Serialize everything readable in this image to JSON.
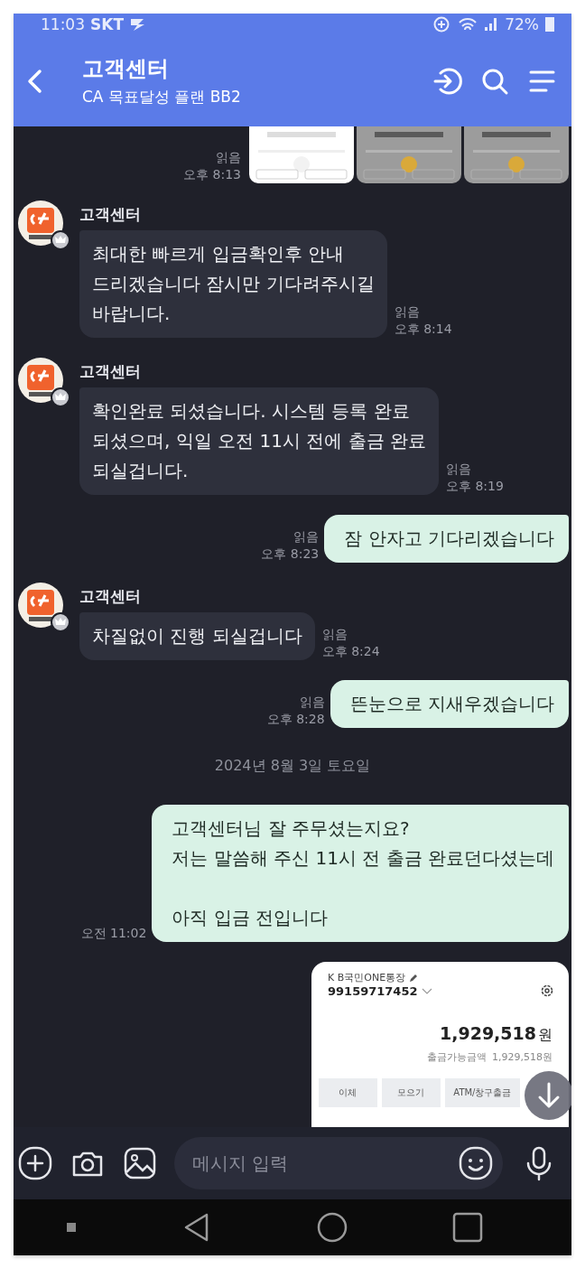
{
  "status_bar": {
    "time": "11:03",
    "carrier": "SKT",
    "battery": "72%"
  },
  "header": {
    "title": "고객센터",
    "subtitle": "CA 목표달성 플랜 BB2"
  },
  "messages": [
    {
      "kind": "images",
      "read": "읽음",
      "time": "오후 8:13"
    },
    {
      "kind": "incoming",
      "sender": "고객센터",
      "text": "최대한 빠르게 입금확인후 안내\n드리겠습니다 잠시만 기다려주시길\n바랍니다.",
      "read": "읽음",
      "time": "오후 8:14"
    },
    {
      "kind": "incoming",
      "sender": "고객센터",
      "text": "확인완료 되셨습니다. 시스템 등록 완료\n되셨으며, 익일 오전 11시 전에 출금 완료\n되실겁니다.",
      "read": "읽음",
      "time": "오후 8:19"
    },
    {
      "kind": "outgoing",
      "text": "잠 안자고 기다리겠습니다",
      "read": "읽음",
      "time": "오후 8:23"
    },
    {
      "kind": "incoming",
      "sender": "고객센터",
      "text": "차질없이 진행 되실겁니다",
      "read": "읽음",
      "time": "오후 8:24"
    },
    {
      "kind": "outgoing",
      "text": "뜬눈으로 지새우겠습니다",
      "read": "읽음",
      "time": "오후 8:28"
    },
    {
      "kind": "date",
      "text": "2024년 8월 3일 토요일"
    },
    {
      "kind": "outgoing",
      "text": "고객센터님 잘 주무셨는지요?\n저는 말씀해 주신 11시 전 출금 완료던다셨는데\n\n아직 입금 전입니다",
      "time": "오전 11:02"
    },
    {
      "kind": "account_card",
      "account_name": "K B국민ONE통장",
      "account_number": "99159717452",
      "balance": "1,929,518",
      "currency": "원",
      "available_label": "출금가능금액",
      "available": "1,929,518원",
      "buttons": [
        "이체",
        "모으기",
        "ATM/창구출금"
      ]
    }
  ],
  "input": {
    "placeholder": "메시지 입력"
  }
}
